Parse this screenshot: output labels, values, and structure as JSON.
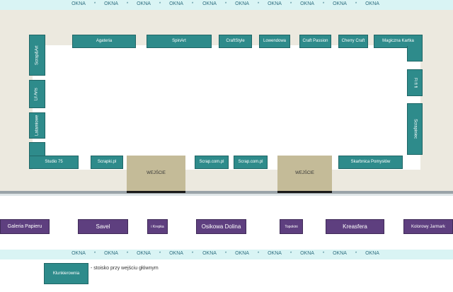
{
  "window_label": "OKNA",
  "window_separator": "*",
  "entrance_label": "WEJŚCIE",
  "inner_booths": {
    "scrapart": "Scrap&Art",
    "agateria": "Agateria",
    "spinart": "SpinArt",
    "craftstyle": "CraftStyle",
    "lowendowa": "Lowendowa",
    "craft_passion": "Craft Passion",
    "cherry_craft": "Cherry Craft",
    "magiczna_kartka": "Magiczna Kartka",
    "lil_arts": "Lil Arts",
    "leftside_small": "Latarniowe",
    "studio75": "Studio 75",
    "scrapki": "Scrapki.pl",
    "scrap_com_1": "Scrap.com.pl",
    "scrap_com_2": "Scrap.com.pl",
    "skarbnica": "Skarbnica Pomysłów",
    "fi_fi": "Fi fi fi",
    "scrapinice": "Scrapiniec"
  },
  "outer_booths": {
    "galeria": "Galeria Papieru",
    "savel": "Savel",
    "krepka": "i Krepka",
    "osikowa": "Osikowa Dolina",
    "topokini": "Topokini",
    "kreasfera": "Kreasfera",
    "kolorowy": "Kolorowy Jarmark"
  },
  "legend": {
    "box_label": "Klunkierownia",
    "text": "- stoisko przy wejściu głównym"
  }
}
